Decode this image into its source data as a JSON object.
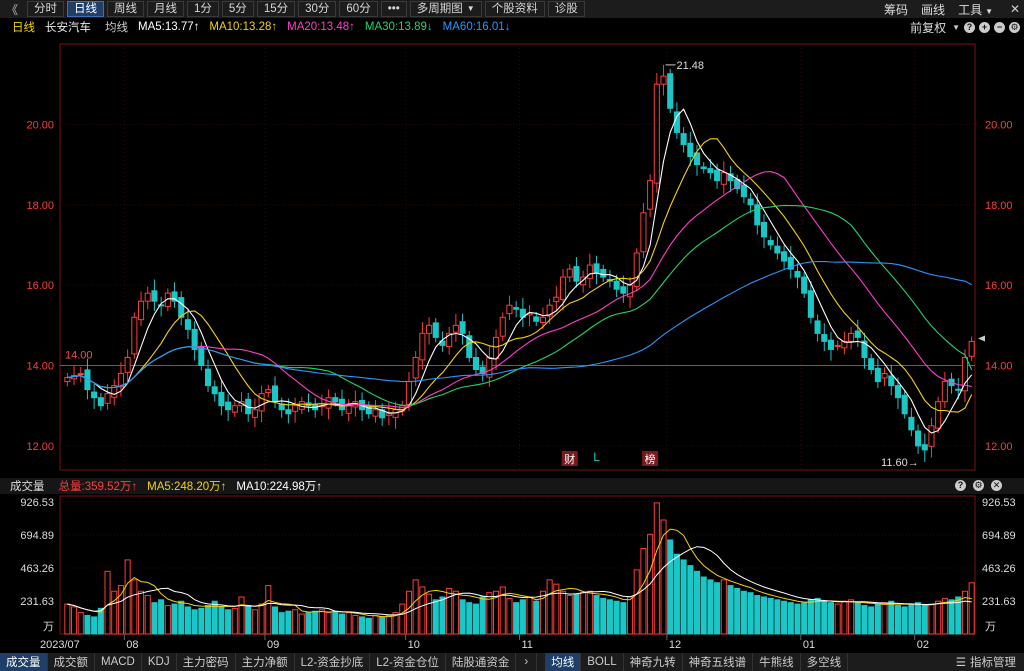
{
  "toolbar": {
    "nav_back": "《",
    "periods": [
      "分时",
      "日线",
      "周线",
      "月线",
      "1分",
      "5分",
      "15分",
      "30分",
      "60分"
    ],
    "active_period": "日线",
    "more": "•••",
    "multi_period": "多周期图",
    "stock_info": "个股资料",
    "diagnosis": "诊股",
    "right": {
      "chip": "筹码",
      "draw": "画线",
      "tools": "工具"
    }
  },
  "ma_bar": {
    "period": "日线",
    "stock_name": "长安汽车",
    "line_type": "均线",
    "ma5": "MA5:13.77↑",
    "ma10": "MA10:13.28↑",
    "ma20": "MA20:13.48↑",
    "ma30": "MA30:13.89↓",
    "ma60": "MA60:16.01↓",
    "adjust": "前复权",
    "colors": {
      "ma5": "#ffffff",
      "ma10": "#f5d20a",
      "ma20": "#ff3ec8",
      "ma30": "#21d36a",
      "ma60": "#2a95ff"
    }
  },
  "price_chart": {
    "y_ticks": [
      "20.00",
      "18.00",
      "16.00",
      "14.00",
      "12.00"
    ],
    "high_label": "21.48",
    "low_label": "11.60",
    "current_line_label": "14.00",
    "markers": {
      "cai": "财",
      "l": "L",
      "bang": "榜"
    }
  },
  "volume_bar": {
    "title": "成交量",
    "total": "总量:359.52万↑",
    "ma5": "MA5:248.20万↑",
    "ma10": "MA10:224.98万↑"
  },
  "volume_chart": {
    "y_ticks": [
      "926.53",
      "694.89",
      "463.26",
      "231.63"
    ],
    "unit": "万",
    "x_labels": [
      "2023/07",
      "08",
      "09",
      "10",
      "11",
      "12",
      "01",
      "02"
    ]
  },
  "bottom_bar": {
    "tabs_left": [
      "成交量",
      "成交额",
      "MACD",
      "KDJ",
      "主力密码",
      "主力净额",
      "L2-资金抄底",
      "L2-资金仓位",
      "陆股通资金"
    ],
    "tabs_right": [
      "均线",
      "BOLL",
      "神奇九转",
      "神奇五线谱",
      "牛熊线",
      "多空线"
    ],
    "manage": "指标管理"
  },
  "chart_data": [
    {
      "type": "candlestick",
      "title": "长安汽车 日线",
      "ylim": [
        11.4,
        22.0
      ],
      "yticks": [
        12,
        14,
        16,
        18,
        20
      ],
      "x_months": [
        "2023/07",
        "08",
        "09",
        "10",
        "11",
        "12",
        "01",
        "02"
      ],
      "month_index": [
        0,
        9,
        30,
        51,
        68,
        90,
        110,
        127
      ],
      "high": 21.48,
      "low": 11.6,
      "reference_line": 14.0,
      "closes": [
        13.7,
        13.75,
        13.8,
        13.4,
        13.2,
        13.0,
        13.3,
        13.5,
        13.8,
        14.2,
        15.2,
        15.6,
        15.8,
        15.6,
        15.5,
        15.8,
        15.6,
        15.2,
        14.9,
        14.4,
        14.0,
        13.5,
        13.3,
        13.0,
        12.9,
        13.0,
        13.1,
        12.8,
        12.9,
        13.3,
        13.4,
        13.1,
        12.9,
        12.8,
        13.0,
        13.1,
        13.0,
        12.9,
        13.0,
        13.2,
        13.1,
        12.9,
        13.0,
        13.1,
        12.9,
        12.8,
        12.9,
        12.7,
        12.8,
        12.9,
        13.0,
        13.6,
        14.2,
        14.8,
        15.0,
        14.7,
        14.5,
        14.8,
        15.0,
        14.8,
        14.2,
        13.9,
        13.8,
        14.2,
        14.7,
        15.2,
        15.5,
        15.4,
        15.2,
        15.3,
        15.1,
        15.2,
        15.5,
        15.7,
        16.2,
        16.4,
        16.1,
        16.2,
        16.5,
        16.3,
        16.2,
        16.1,
        15.9,
        15.8,
        16.0,
        16.8,
        17.8,
        18.6,
        21.0,
        21.2,
        20.4,
        19.8,
        19.5,
        19.2,
        19.0,
        18.9,
        18.8,
        18.6,
        18.8,
        18.6,
        18.4,
        18.2,
        18.0,
        17.5,
        17.2,
        17.0,
        16.8,
        16.6,
        16.4,
        16.2,
        15.8,
        15.2,
        14.8,
        14.6,
        14.4,
        14.5,
        14.6,
        14.8,
        14.7,
        14.2,
        13.9,
        13.6,
        13.8,
        13.5,
        13.2,
        12.8,
        12.4,
        12.0,
        11.9,
        12.5,
        13.1,
        13.6,
        13.5,
        13.4,
        14.2,
        14.6
      ],
      "ma_series": [
        {
          "name": "MA5",
          "value": 13.77,
          "color": "#ffffff"
        },
        {
          "name": "MA10",
          "value": 13.28,
          "color": "#f5d20a"
        },
        {
          "name": "MA20",
          "value": 13.48,
          "color": "#ff3ec8"
        },
        {
          "name": "MA30",
          "value": 13.89,
          "color": "#21d36a"
        },
        {
          "name": "MA60",
          "value": 16.01,
          "color": "#2a95ff"
        }
      ]
    },
    {
      "type": "bar",
      "title": "成交量",
      "unit": "万",
      "ylim": [
        0,
        926.53
      ],
      "yticks": [
        926.53,
        694.89,
        463.26,
        231.63
      ],
      "values": [
        210,
        190,
        150,
        130,
        120,
        180,
        440,
        300,
        340,
        520,
        380,
        300,
        270,
        220,
        240,
        200,
        210,
        230,
        190,
        170,
        180,
        200,
        230,
        190,
        170,
        180,
        260,
        200,
        170,
        210,
        340,
        190,
        150,
        160,
        170,
        140,
        150,
        160,
        170,
        150,
        160,
        140,
        150,
        130,
        120,
        110,
        130,
        120,
        130,
        150,
        210,
        300,
        380,
        330,
        280,
        240,
        260,
        320,
        300,
        240,
        220,
        210,
        260,
        290,
        300,
        330,
        250,
        220,
        240,
        260,
        230,
        300,
        380,
        350,
        300,
        270,
        280,
        290,
        300,
        270,
        250,
        240,
        230,
        220,
        260,
        450,
        600,
        700,
        920,
        800,
        660,
        560,
        520,
        480,
        440,
        400,
        380,
        360,
        380,
        340,
        320,
        300,
        290,
        270,
        260,
        250,
        240,
        230,
        220,
        210,
        220,
        240,
        250,
        230,
        220,
        210,
        230,
        240,
        220,
        200,
        190,
        210,
        220,
        230,
        200,
        190,
        210,
        220,
        200,
        210,
        230,
        250,
        240,
        260,
        300,
        359.52
      ],
      "ma5": 248.2,
      "ma10": 224.98,
      "xlabels": [
        "2023/07",
        "08",
        "09",
        "10",
        "11",
        "12",
        "01",
        "02"
      ]
    }
  ]
}
